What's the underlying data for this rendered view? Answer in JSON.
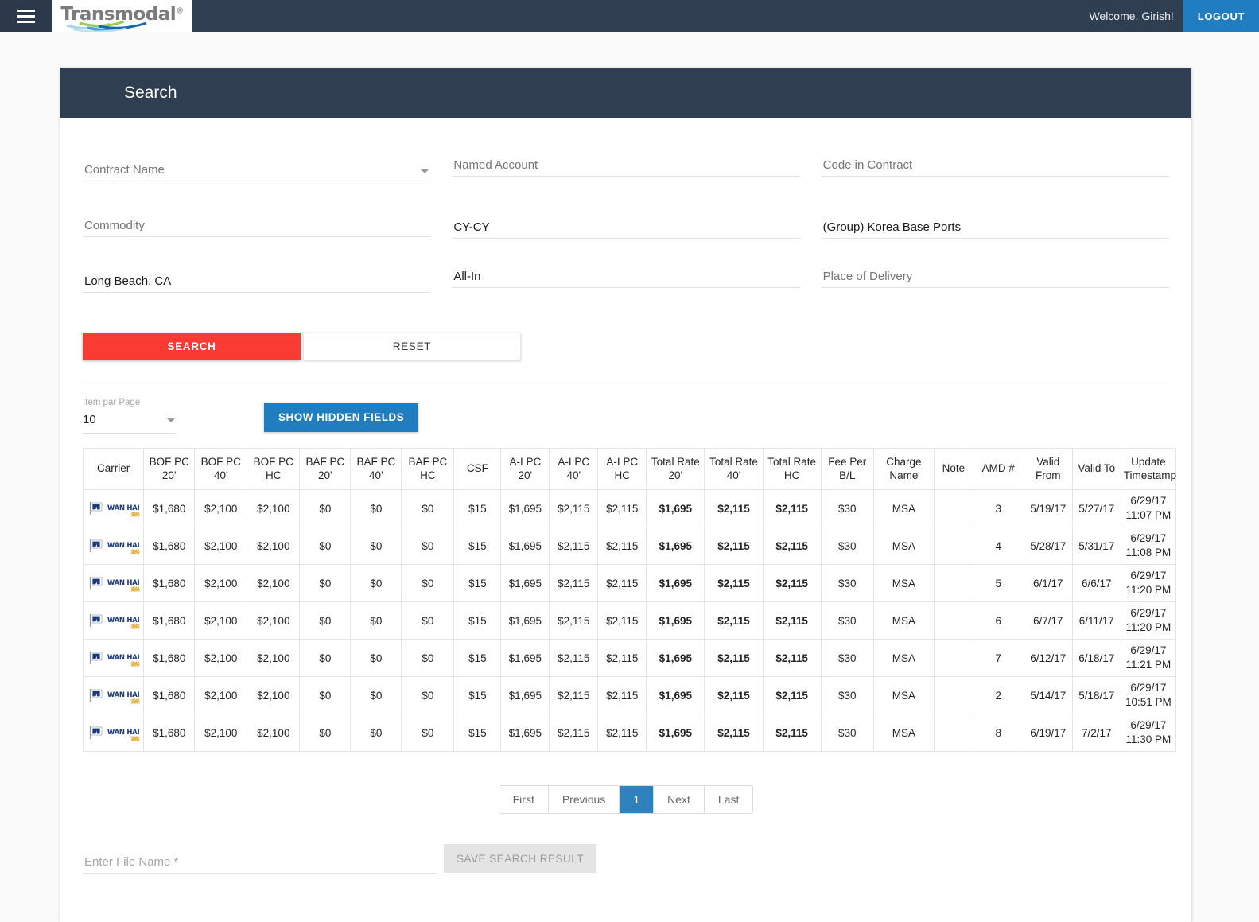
{
  "navbar": {
    "menu_icon": "hamburger-icon",
    "brand_name": "Transmodal",
    "brand_reg": "®",
    "welcome": "Welcome, Girish!",
    "logout_label": "LOGOUT",
    "accent_blue": "#1f7dc0",
    "navy": "#2f3e50"
  },
  "card": {
    "title": "Search"
  },
  "search_form": {
    "fields": [
      {
        "name": "contract-name",
        "label": "Contract Name",
        "value": "",
        "placeholder": "Contract Name",
        "has_dropdown": true
      },
      {
        "name": "named-account",
        "label": "Named Account",
        "value": "",
        "placeholder": "Named Account",
        "has_dropdown": false
      },
      {
        "name": "code-in-contract",
        "label": "Code in Contract",
        "value": "",
        "placeholder": "Code in Contract",
        "has_dropdown": false
      },
      {
        "name": "commodity",
        "label": "Commodity",
        "value": "",
        "placeholder": "Commodity",
        "has_dropdown": false
      },
      {
        "name": "service-type",
        "label": "CY-CY",
        "value": "CY-CY",
        "placeholder": "",
        "has_dropdown": false
      },
      {
        "name": "place-of-receipt",
        "label": "(Group) Korea Base Ports",
        "value": "(Group) Korea Base Ports",
        "placeholder": "",
        "has_dropdown": false
      },
      {
        "name": "port-of-discharge",
        "label": "Long Beach, CA",
        "value": "Long Beach, CA",
        "placeholder": "",
        "has_dropdown": false
      },
      {
        "name": "rate-type",
        "label": "All-In",
        "value": "All-In",
        "placeholder": "",
        "has_dropdown": false
      },
      {
        "name": "place-of-delivery",
        "label": "Place of Delivery",
        "value": "",
        "placeholder": "Place of Delivery",
        "has_dropdown": false
      }
    ],
    "search_label": "SEARCH",
    "reset_label": "RESET",
    "search_color": "#f93b33"
  },
  "toolbar": {
    "items_per_page_label": "Item par Page",
    "items_per_page_value": "10",
    "show_hidden_label": "SHOW HIDDEN FIELDS"
  },
  "table": {
    "columns": [
      "Carrier",
      "BOF PC 20'",
      "BOF PC 40'",
      "BOF PC HC",
      "BAF PC 20'",
      "BAF PC 40'",
      "BAF PC HC",
      "CSF",
      "A-I PC 20'",
      "A-I PC 40'",
      "A-I PC HC",
      "Total Rate 20'",
      "Total Rate 40'",
      "Total Rate HC",
      "Fee Per B/L",
      "Charge Name",
      "Note",
      "AMD #",
      "Valid From",
      "Valid To",
      "Update Timestamp"
    ],
    "carrier_name": "WAN HAI",
    "rows": [
      {
        "carrier": "WAN HAI",
        "bof_pc_20": "$1,680",
        "bof_pc_40": "$2,100",
        "bof_pc_hc": "$2,100",
        "baf_pc_20": "$0",
        "baf_pc_40": "$0",
        "baf_pc_hc": "$0",
        "csf": "$15",
        "ai_pc_20": "$1,695",
        "ai_pc_40": "$2,115",
        "ai_pc_hc": "$2,115",
        "total_20": "$1,695",
        "total_40": "$2,115",
        "total_hc": "$2,115",
        "fee_per_bl": "$30",
        "charge_name": "MSA",
        "note": "",
        "amd": "3",
        "valid_from": "5/19/17",
        "valid_to": "5/27/17",
        "stamp_date": "6/29/17",
        "stamp_time": "11:07 PM"
      },
      {
        "carrier": "WAN HAI",
        "bof_pc_20": "$1,680",
        "bof_pc_40": "$2,100",
        "bof_pc_hc": "$2,100",
        "baf_pc_20": "$0",
        "baf_pc_40": "$0",
        "baf_pc_hc": "$0",
        "csf": "$15",
        "ai_pc_20": "$1,695",
        "ai_pc_40": "$2,115",
        "ai_pc_hc": "$2,115",
        "total_20": "$1,695",
        "total_40": "$2,115",
        "total_hc": "$2,115",
        "fee_per_bl": "$30",
        "charge_name": "MSA",
        "note": "",
        "amd": "4",
        "valid_from": "5/28/17",
        "valid_to": "5/31/17",
        "stamp_date": "6/29/17",
        "stamp_time": "11:08 PM"
      },
      {
        "carrier": "WAN HAI",
        "bof_pc_20": "$1,680",
        "bof_pc_40": "$2,100",
        "bof_pc_hc": "$2,100",
        "baf_pc_20": "$0",
        "baf_pc_40": "$0",
        "baf_pc_hc": "$0",
        "csf": "$15",
        "ai_pc_20": "$1,695",
        "ai_pc_40": "$2,115",
        "ai_pc_hc": "$2,115",
        "total_20": "$1,695",
        "total_40": "$2,115",
        "total_hc": "$2,115",
        "fee_per_bl": "$30",
        "charge_name": "MSA",
        "note": "",
        "amd": "5",
        "valid_from": "6/1/17",
        "valid_to": "6/6/17",
        "stamp_date": "6/29/17",
        "stamp_time": "11:20 PM"
      },
      {
        "carrier": "WAN HAI",
        "bof_pc_20": "$1,680",
        "bof_pc_40": "$2,100",
        "bof_pc_hc": "$2,100",
        "baf_pc_20": "$0",
        "baf_pc_40": "$0",
        "baf_pc_hc": "$0",
        "csf": "$15",
        "ai_pc_20": "$1,695",
        "ai_pc_40": "$2,115",
        "ai_pc_hc": "$2,115",
        "total_20": "$1,695",
        "total_40": "$2,115",
        "total_hc": "$2,115",
        "fee_per_bl": "$30",
        "charge_name": "MSA",
        "note": "",
        "amd": "6",
        "valid_from": "6/7/17",
        "valid_to": "6/11/17",
        "stamp_date": "6/29/17",
        "stamp_time": "11:20 PM"
      },
      {
        "carrier": "WAN HAI",
        "bof_pc_20": "$1,680",
        "bof_pc_40": "$2,100",
        "bof_pc_hc": "$2,100",
        "baf_pc_20": "$0",
        "baf_pc_40": "$0",
        "baf_pc_hc": "$0",
        "csf": "$15",
        "ai_pc_20": "$1,695",
        "ai_pc_40": "$2,115",
        "ai_pc_hc": "$2,115",
        "total_20": "$1,695",
        "total_40": "$2,115",
        "total_hc": "$2,115",
        "fee_per_bl": "$30",
        "charge_name": "MSA",
        "note": "",
        "amd": "7",
        "valid_from": "6/12/17",
        "valid_to": "6/18/17",
        "stamp_date": "6/29/17",
        "stamp_time": "11:21 PM"
      },
      {
        "carrier": "WAN HAI",
        "bof_pc_20": "$1,680",
        "bof_pc_40": "$2,100",
        "bof_pc_hc": "$2,100",
        "baf_pc_20": "$0",
        "baf_pc_40": "$0",
        "baf_pc_hc": "$0",
        "csf": "$15",
        "ai_pc_20": "$1,695",
        "ai_pc_40": "$2,115",
        "ai_pc_hc": "$2,115",
        "total_20": "$1,695",
        "total_40": "$2,115",
        "total_hc": "$2,115",
        "fee_per_bl": "$30",
        "charge_name": "MSA",
        "note": "",
        "amd": "2",
        "valid_from": "5/14/17",
        "valid_to": "5/18/17",
        "stamp_date": "6/29/17",
        "stamp_time": "10:51 PM"
      },
      {
        "carrier": "WAN HAI",
        "bof_pc_20": "$1,680",
        "bof_pc_40": "$2,100",
        "bof_pc_hc": "$2,100",
        "baf_pc_20": "$0",
        "baf_pc_40": "$0",
        "baf_pc_hc": "$0",
        "csf": "$15",
        "ai_pc_20": "$1,695",
        "ai_pc_40": "$2,115",
        "ai_pc_hc": "$2,115",
        "total_20": "$1,695",
        "total_40": "$2,115",
        "total_hc": "$2,115",
        "fee_per_bl": "$30",
        "charge_name": "MSA",
        "note": "",
        "amd": "8",
        "valid_from": "6/19/17",
        "valid_to": "7/2/17",
        "stamp_date": "6/29/17",
        "stamp_time": "11:30 PM"
      }
    ]
  },
  "pagination": {
    "first": "First",
    "previous": "Previous",
    "current_page": "1",
    "next": "Next",
    "last": "Last",
    "active_color": "#2d81bd"
  },
  "save_section": {
    "file_name_value": "",
    "file_name_placeholder": "Enter File Name *",
    "save_label": "SAVE SEARCH RESULT"
  }
}
